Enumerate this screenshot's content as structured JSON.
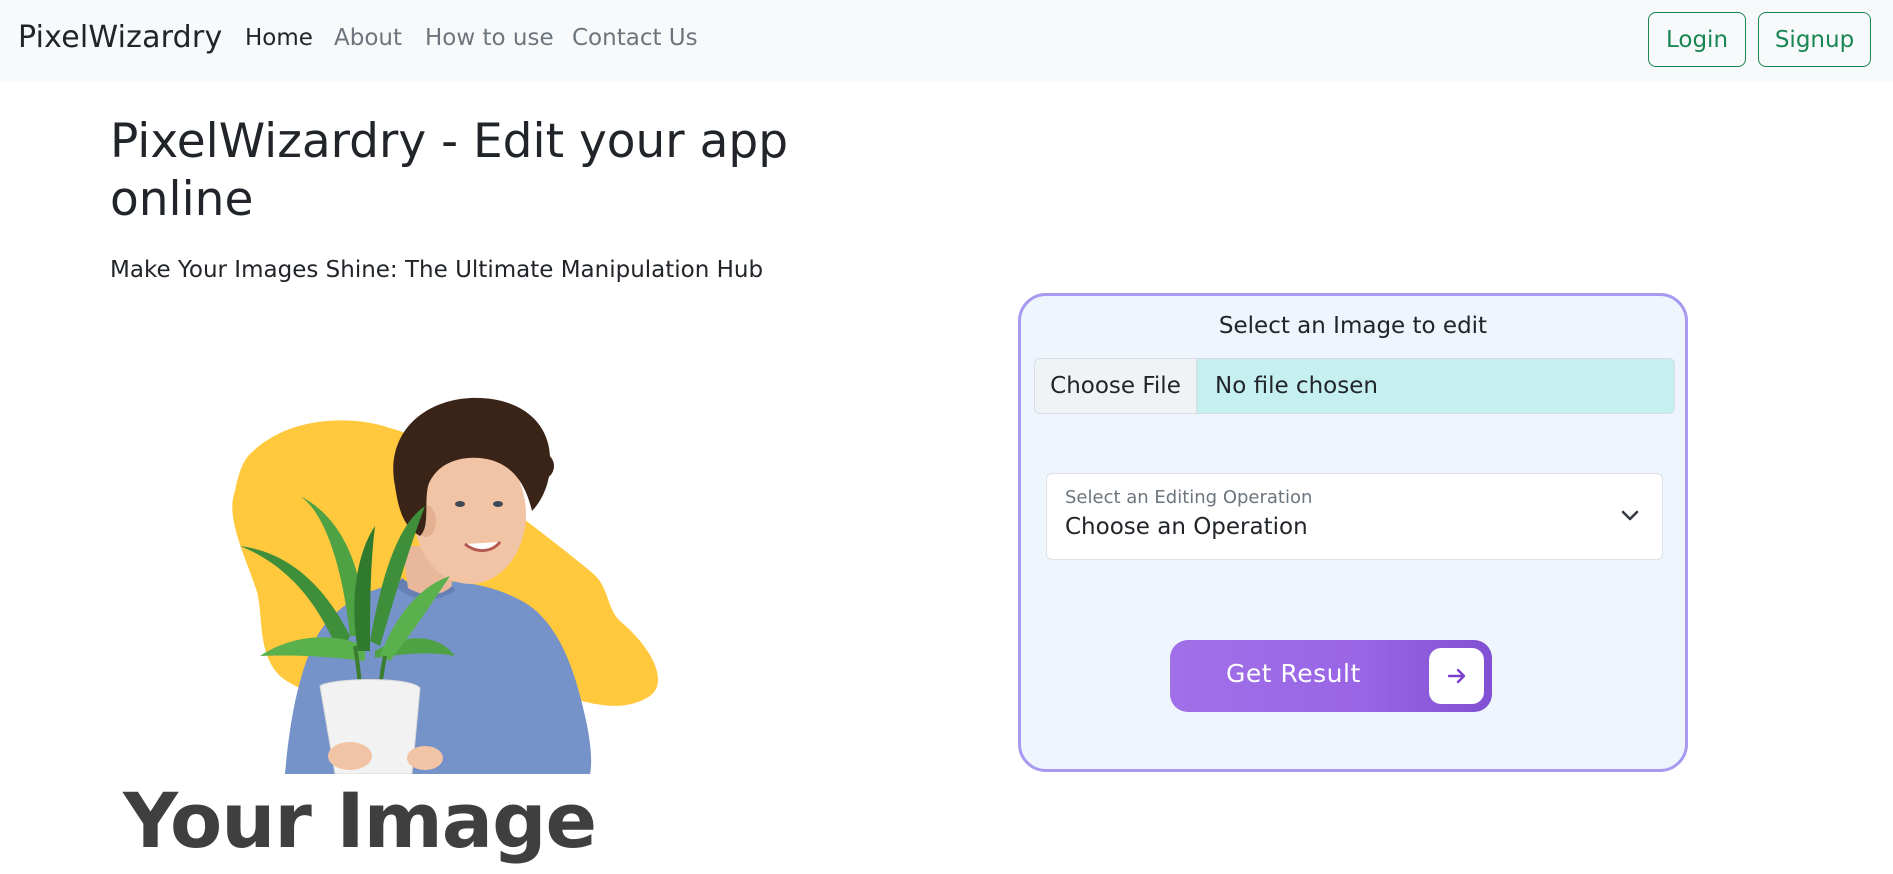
{
  "navbar": {
    "brand": "PixelWizardry",
    "links": [
      {
        "label": "Home",
        "active": true
      },
      {
        "label": "About",
        "active": false
      },
      {
        "label": "How to use",
        "active": false
      },
      {
        "label": "Contact Us",
        "active": false
      }
    ],
    "login_label": "Login",
    "signup_label": "Signup"
  },
  "hero": {
    "title": "PixelWizardry - Edit your app online",
    "subtitle": "Make Your Images Shine: The Ultimate Manipulation Hub",
    "illustration": "man-holding-plant-illustration",
    "caption": "Your Image"
  },
  "editor": {
    "title": "Select an Image to edit",
    "file_button": "Choose File",
    "file_status": "No file chosen",
    "select_label": "Select an Editing Operation",
    "select_value": "Choose an Operation",
    "select_icon": "chevron-down-icon",
    "submit_label": "Get Result",
    "submit_icon": "arrow-right-icon"
  },
  "colors": {
    "accent_purple": "#9b6be7",
    "card_border": "#a89af0",
    "card_bg": "#eef5fd",
    "success_green": "#198754",
    "blob_yellow": "#ffc83d",
    "file_field_bg": "#c6f0ef"
  }
}
